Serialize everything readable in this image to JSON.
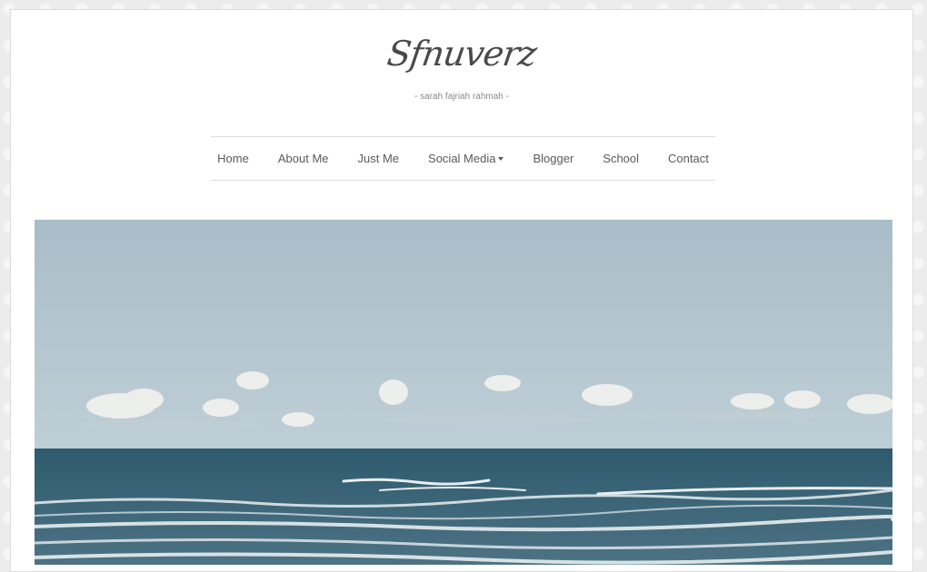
{
  "site": {
    "title": "Sfnuverz",
    "tagline": "- sarah fajriah rahmah -"
  },
  "nav": {
    "items": [
      {
        "label": "Home"
      },
      {
        "label": "About Me"
      },
      {
        "label": "Just Me"
      },
      {
        "label": "Social Media",
        "has_dropdown": true
      },
      {
        "label": "Blogger"
      },
      {
        "label": "School"
      },
      {
        "label": "Contact"
      }
    ]
  },
  "hero": {
    "subject": "sea-horizon-photo",
    "colors": {
      "sky_top": "#a9bdc8",
      "sky_bottom": "#c9d7de",
      "sea_deep": "#2e5a6e",
      "sea_near": "#4d7384",
      "foam": "#e8eef0"
    }
  }
}
